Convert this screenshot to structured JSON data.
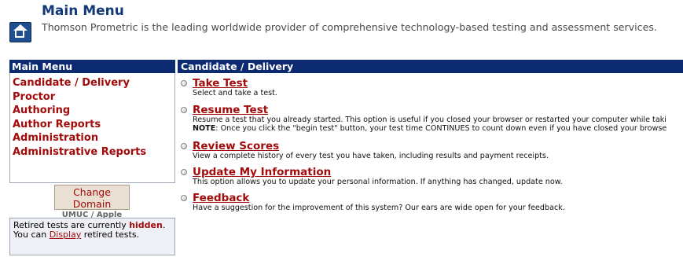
{
  "header": {
    "title": "Main Menu",
    "tagline": "Thomson Prometric is the leading worldwide provider of comprehensive technology-based testing and assessment services."
  },
  "sidebar": {
    "heading": "Main Menu",
    "items": [
      {
        "label": "Candidate / Delivery"
      },
      {
        "label": "Proctor"
      },
      {
        "label": "Authoring"
      },
      {
        "label": "Author Reports"
      },
      {
        "label": "Administration"
      },
      {
        "label": "Administrative Reports"
      }
    ],
    "change_domain_label": "Change Domain",
    "domain_name": "UMUC / Apple",
    "retired": {
      "prefix": "Retired tests are currently",
      "status": "hidden",
      "middle": ". You can",
      "link": "Display",
      "suffix": "retired tests."
    }
  },
  "content": {
    "heading": "Candidate / Delivery",
    "items": [
      {
        "title": "Take Test",
        "desc": "Select and take a test."
      },
      {
        "title": "Resume Test",
        "desc": "Resume a test that you already started. This option is useful if you closed your browser or restarted your computer while taki",
        "note_label": "NOTE",
        "note": ": Once you click the \"begin test\" button, your test time CONTINUES to count down even if you have closed your browse"
      },
      {
        "title": "Review Scores",
        "desc": "View a complete history of every test you have taken, including results and payment receipts."
      },
      {
        "title": "Update My Information",
        "desc": "This option allows you to update your personal information. If anything has changed, update now."
      },
      {
        "title": "Feedback",
        "desc": "Have a suggestion for the improvement of this system? Our ears are wide open for your feedback."
      }
    ]
  },
  "icons": {
    "home": "home-icon",
    "radio": "radio-bullet-icon"
  },
  "colors": {
    "nav_bar": "#0b2a6f",
    "link_red": "#a10b0b",
    "title_blue": "#123a7a"
  }
}
